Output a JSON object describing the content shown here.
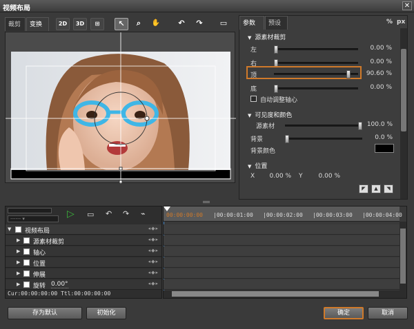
{
  "window": {
    "title": "视频布局",
    "close_label": "✕"
  },
  "left_tabs": [
    {
      "label": "裁剪"
    },
    {
      "label": "变换"
    }
  ],
  "toolbar": {
    "btn_2d": "2D",
    "btn_3d": "3D",
    "btn_grid": "⊞",
    "btn_pointer": "↖",
    "btn_zoom": "⌕",
    "btn_hand": "✋",
    "btn_undo": "↶",
    "btn_redo": "↷",
    "btn_fit": "▭"
  },
  "right_tabs": [
    {
      "label": "参数"
    },
    {
      "label": "预设"
    }
  ],
  "units": {
    "percent": "%",
    "px": "px"
  },
  "params": {
    "crop_section": "源素材裁剪",
    "crop_left": {
      "label": "左",
      "value": "0.00 %",
      "level": 0.0
    },
    "crop_right": {
      "label": "右",
      "value": "0.00 %",
      "level": 0.0
    },
    "crop_top": {
      "label": "顶",
      "value": "90.60 %",
      "level": 0.906
    },
    "crop_bottom": {
      "label": "底",
      "value": "0.00 %",
      "level": 0.0
    },
    "auto_axis": "自动调整轴心",
    "visibility_section": "可见度和颜色",
    "source": {
      "label": "源素材",
      "value": "100.0 %",
      "level": 1.0
    },
    "background": {
      "label": "背景",
      "value": "0.0 %",
      "level": 0.0
    },
    "bg_color": {
      "label": "背景颜色",
      "color": "#000000"
    },
    "position_section": "位置",
    "pos_x": {
      "label": "X",
      "value": "0.00 %"
    },
    "pos_y": {
      "label": "Y",
      "value": "0.00 %"
    }
  },
  "timeline": {
    "ruler": [
      "00:00:00:00",
      "|00:00:01:00",
      "|00:00:02:00",
      "|00:00:03:00",
      "|00:00:04:00"
    ],
    "rows": [
      {
        "label": "视频布局"
      },
      {
        "label": "源素材裁剪"
      },
      {
        "label": "轴心"
      },
      {
        "label": "位置"
      },
      {
        "label": "伸展"
      },
      {
        "label": "旋转"
      }
    ],
    "rotate_value": "0.00°",
    "timecode": "Cur:00:00:00:00 Ttl:00:00:00:00"
  },
  "buttons": {
    "save_default": "存为默认",
    "init": "初始化",
    "ok": "确定",
    "cancel": "取消"
  },
  "colors": {
    "accent": "#d07a2a",
    "play": "#3bb43b",
    "cursor": "#4a8ac8"
  }
}
